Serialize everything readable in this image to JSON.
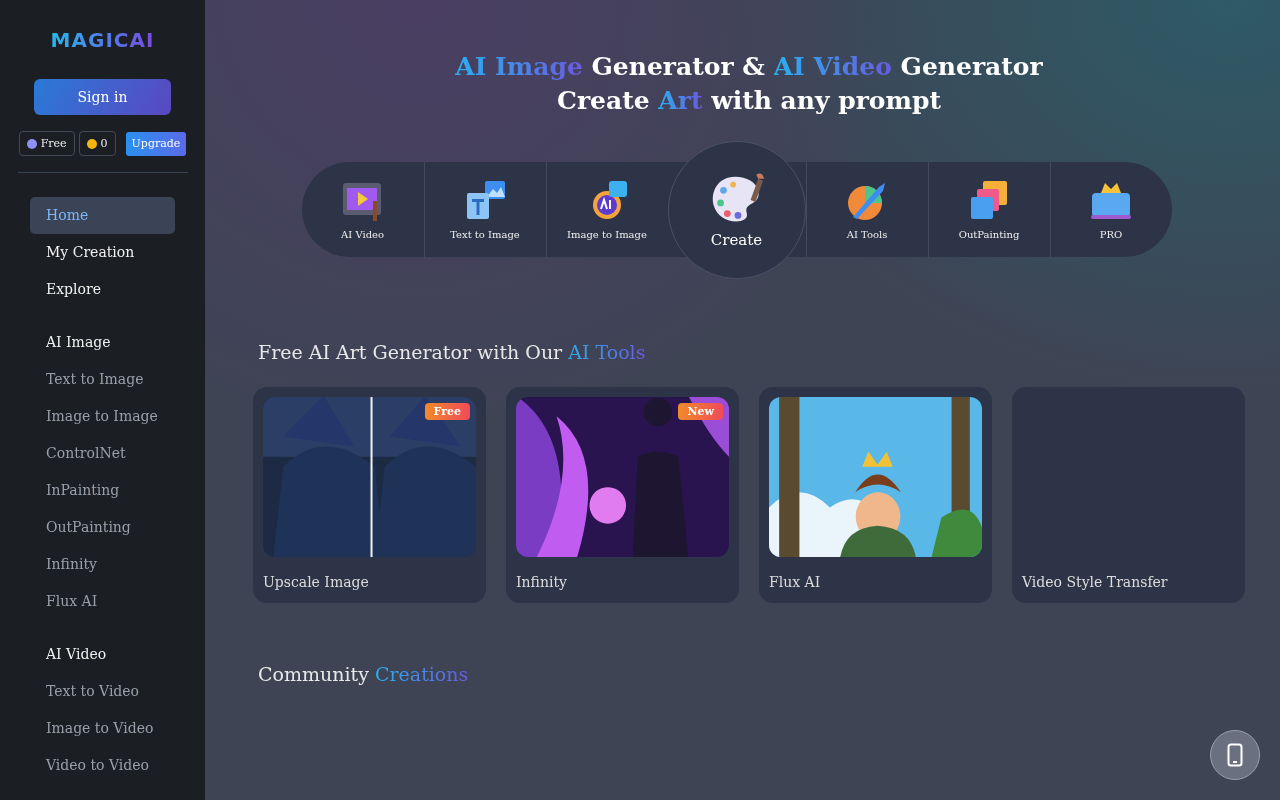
{
  "sidebar": {
    "logo": "MAGICAI",
    "sign_in": "Sign in",
    "plan": "Free",
    "credits": "0",
    "upgrade": "Upgrade",
    "sections": [
      {
        "items": [
          {
            "label": "Home",
            "selected": true
          },
          {
            "label": "My Creation",
            "selected": false
          },
          {
            "label": "Explore",
            "selected": false
          }
        ]
      },
      {
        "heading": "AI Image",
        "items": [
          {
            "label": "Text to Image",
            "selected": false
          },
          {
            "label": "Image to Image",
            "selected": false
          },
          {
            "label": "ControlNet",
            "selected": false
          },
          {
            "label": "InPainting",
            "selected": false
          },
          {
            "label": "OutPainting",
            "selected": false
          },
          {
            "label": "Infinity",
            "selected": false
          },
          {
            "label": "Flux AI",
            "selected": false
          }
        ]
      },
      {
        "heading": "AI Video",
        "items": [
          {
            "label": "Text to Video",
            "selected": false
          },
          {
            "label": "Image to Video",
            "selected": false
          },
          {
            "label": "Video to Video",
            "selected": false
          }
        ]
      }
    ]
  },
  "hero": {
    "lines": [
      [
        {
          "text": "AI Image",
          "accent": true
        },
        {
          "text": " Generator & ",
          "accent": false
        },
        {
          "text": "AI Video",
          "accent": true
        },
        {
          "text": " Generator",
          "accent": false
        }
      ],
      [
        {
          "text": "Create ",
          "accent": false
        },
        {
          "text": "Art",
          "accent": true
        },
        {
          "text": " with any prompt",
          "accent": false
        }
      ]
    ]
  },
  "tools": [
    {
      "kind": "tool",
      "label": "AI Video"
    },
    {
      "kind": "tool",
      "label": "Text to Image"
    },
    {
      "kind": "tool",
      "label": "Image to Image"
    },
    {
      "kind": "center",
      "label": "Create"
    },
    {
      "kind": "tool",
      "label": "AI Tools"
    },
    {
      "kind": "tool",
      "label": "OutPainting"
    },
    {
      "kind": "tool",
      "label": "PRO"
    }
  ],
  "tools_section": {
    "title": [
      {
        "text": "Free AI Art Generator with Our ",
        "accent": false
      },
      {
        "text": "AI Tools",
        "accent": true
      }
    ],
    "cards": [
      {
        "title": "Upscale Image",
        "badge": "Free",
        "kind": "picture"
      },
      {
        "title": "Infinity",
        "badge": "New",
        "kind": "picture"
      },
      {
        "title": "Flux AI",
        "kind": "picture"
      },
      {
        "title": "Video Style Transfer"
      }
    ]
  },
  "community": {
    "title": [
      {
        "text": "Community ",
        "accent": false
      },
      {
        "text": "Creations",
        "accent": true
      }
    ]
  }
}
